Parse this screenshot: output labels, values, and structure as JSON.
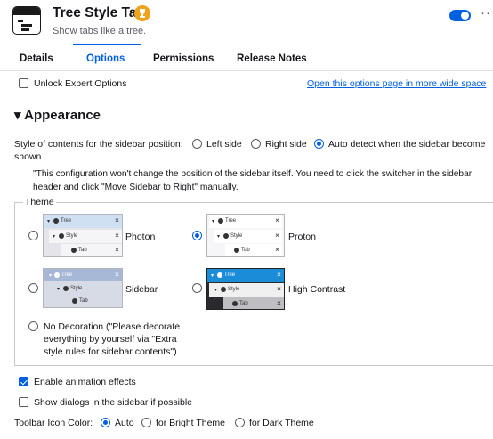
{
  "header": {
    "title": "Tree Style Tab",
    "description": "Show tabs like a tree.",
    "more_label": "···",
    "toggle_on": true
  },
  "tabs": [
    {
      "label": "Details",
      "active": false
    },
    {
      "label": "Options",
      "active": true
    },
    {
      "label": "Permissions",
      "active": false
    },
    {
      "label": "Release Notes",
      "active": false
    }
  ],
  "options": {
    "unlock_expert": "Unlock Expert Options",
    "wide_link": "Open this options page in more wide space",
    "section_title": "▾ Appearance",
    "sidebar_position": {
      "label": "Style of contents for the sidebar position:",
      "left": "Left side",
      "right": "Right side",
      "auto": "Auto detect when the sidebar become",
      "auto_cont": "shown",
      "note_line1": "\"This configuration won't change the position of the sidebar itself. You need to click the switcher in the sidebar",
      "note_line2": "header and click \"Move Sidebar to Right\" manually."
    },
    "theme": {
      "legend": "Theme",
      "photon": "Photon",
      "proton": "Proton",
      "sidebar": "Sidebar",
      "high_contrast": "High Contrast",
      "no_decoration_1": "No Decoration (\"Please decorate",
      "no_decoration_2": "everything by yourself via \"Extra",
      "no_decoration_3": "style rules for sidebar contents\")",
      "selected": "Proton",
      "preview_labels": {
        "tree": "Tree",
        "style": "Style",
        "tab": "Tab"
      },
      "close_glyph": "×"
    },
    "enable_animation": "Enable animation effects",
    "show_dialogs": "Show dialogs in the sidebar if possible",
    "toolbar_icon_color": {
      "label": "Toolbar Icon Color:",
      "auto": "Auto",
      "bright": "for Bright Theme",
      "dark": "for Dark Theme",
      "selected": "Auto"
    }
  },
  "colors": {
    "accent": "#0060df",
    "trophy": "#f0a21a",
    "photon_header": "#cfe0f2",
    "sidebar_theme_header": "#a7b7d6",
    "high_contrast_selected": "#1a8cd8"
  }
}
